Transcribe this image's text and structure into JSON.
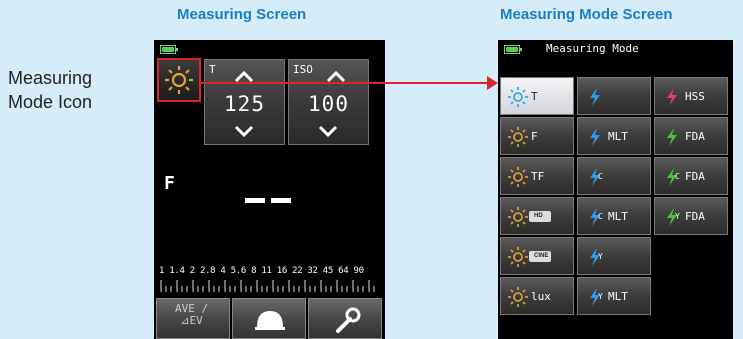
{
  "labels": {
    "measuring_screen_title": "Measuring Screen",
    "measuring_mode_screen_title": "Measuring Mode Screen",
    "callout_line1": "Measuring",
    "callout_line2": "Mode Icon"
  },
  "measuring_screen": {
    "t_label": "T",
    "t_value": "125",
    "iso_label": "ISO",
    "iso_value": "100",
    "f_label": "F",
    "f_scale": "1  1.4  2  2.8  4  5.6  8  11  16  22  32  45  64  90",
    "ave_line1": "AVE /",
    "ave_line2": "⊿EV"
  },
  "mode_screen": {
    "title": "Measuring Mode",
    "cells": [
      {
        "label": "T"
      },
      {
        "label": ""
      },
      {
        "label": "HSS"
      },
      {
        "label": "F"
      },
      {
        "label": "MLT"
      },
      {
        "label": "FDA"
      },
      {
        "label": "TF"
      },
      {
        "label": "MLT"
      },
      {
        "label": "FDA"
      },
      {
        "label": ""
      },
      {
        "label": "MLT"
      },
      {
        "label": "FDA"
      },
      {
        "label": ""
      },
      {
        "label": ""
      },
      {
        "label": "lux"
      },
      {
        "label": "MLT"
      }
    ],
    "sub_c": "C",
    "sub_y": "Y",
    "hd": "HD",
    "cine": "CINE"
  },
  "colors": {
    "accent": "#1a7fc9",
    "highlight": "#d9252b",
    "sun": "#e8a23c",
    "flash": "#2aa1e8",
    "flash_green": "#45c63a",
    "flash_pink": "#e8358f"
  }
}
